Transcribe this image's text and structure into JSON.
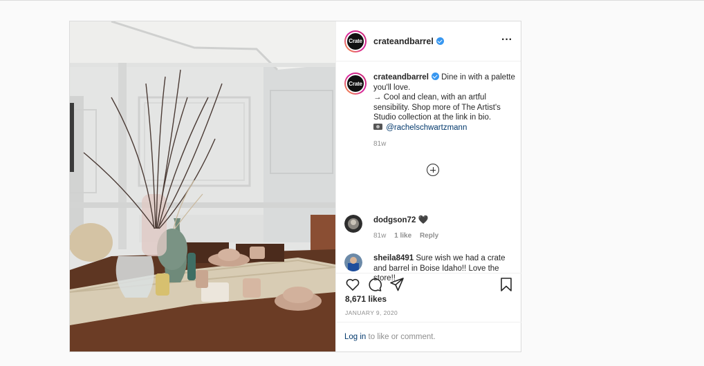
{
  "post": {
    "username": "crateandbarrel",
    "avatar_text": "Crate",
    "more_icon": "more-options-icon",
    "caption": {
      "username": "crateandbarrel",
      "text_line1": "Dine in with a palette you'll love.",
      "text_line2": "→ Cool and clean, with an artful sensibility. Shop more of The Artist's Studio collection at the link in bio.",
      "mention": "@rachelschwartzmann",
      "time": "81w"
    },
    "comments": [
      {
        "username": "dodgson72",
        "text": "🖤",
        "time": "81w",
        "likes": "1 like",
        "reply": "Reply"
      },
      {
        "username": "sheila8491",
        "text": "Sure wish we had a crate and barrel in Boise Idaho!! Love the store!!"
      }
    ],
    "likes": "8,671 likes",
    "date": "JANUARY 9, 2020",
    "login": {
      "link": "Log in",
      "text": " to like or comment."
    }
  },
  "colors": {
    "verified": "#3897f0",
    "link": "#00376b",
    "muted": "#8e8e8e"
  }
}
